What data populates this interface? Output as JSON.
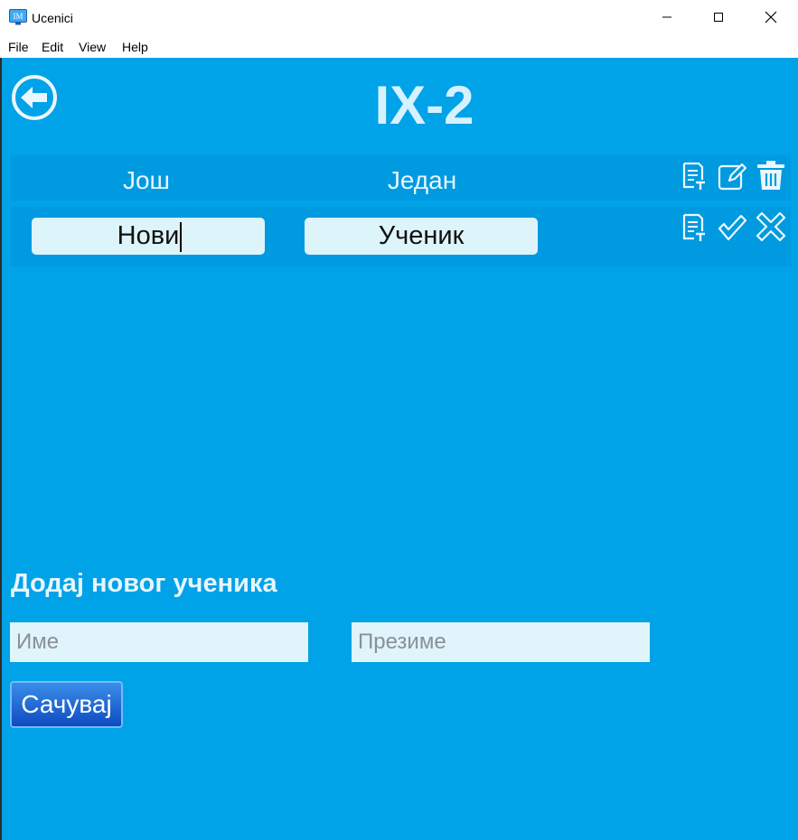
{
  "window": {
    "title": "Ucenici",
    "icon_text": "IM"
  },
  "menu": {
    "items": [
      {
        "label": "File"
      },
      {
        "label": "Edit"
      },
      {
        "label": "View"
      },
      {
        "label": "Help"
      }
    ]
  },
  "header": {
    "title": "IX-2"
  },
  "students": [
    {
      "first_name": "Још",
      "last_name": "Један",
      "actions": [
        "details-icon",
        "edit-icon",
        "trash-icon"
      ]
    },
    {
      "first_name": "Нови",
      "last_name": "Ученик",
      "editing": true,
      "actions": [
        "details-icon",
        "confirm-icon",
        "cancel-icon"
      ]
    }
  ],
  "add_form": {
    "title": "Додај новог ученика",
    "first_name_placeholder": "Име",
    "last_name_placeholder": "Презиме",
    "save_label": "Сачувај"
  },
  "colors": {
    "background": "#00a2e8",
    "row_background": "#009ae0",
    "light_text": "#d6f2ff",
    "input_background": "#def4fb",
    "button_top": "#3a8ee8",
    "button_bottom": "#0f4bc2"
  }
}
